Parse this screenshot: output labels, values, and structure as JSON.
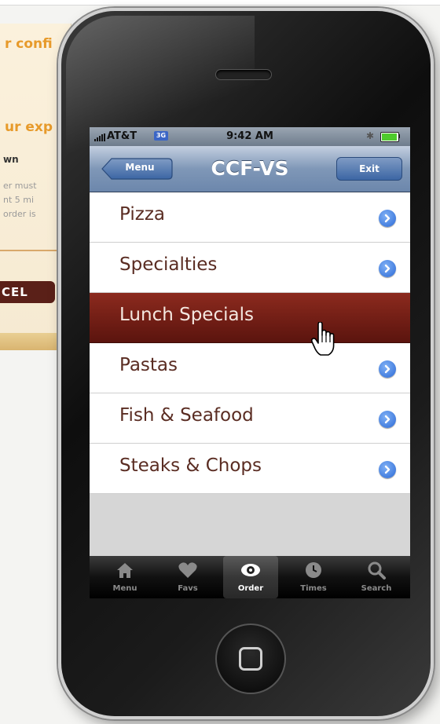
{
  "background_page": {
    "heading_1": "r confi",
    "heading_2": "ur exp",
    "subheading": "wn",
    "body_lines": [
      "er must",
      "nt 5 mi",
      "order is"
    ],
    "cancel_label": "CEL"
  },
  "status_bar": {
    "carrier": "AT&T",
    "network": "3G",
    "time": "9:42 AM",
    "bluetooth_icon": "bluetooth-icon",
    "battery_level": 1.0
  },
  "nav_bar": {
    "title": "CCF-VS",
    "left_button": "Menu",
    "right_button": "Exit"
  },
  "menu_items": [
    {
      "label": "Pizza",
      "selected": false
    },
    {
      "label": "Specialties",
      "selected": false
    },
    {
      "label": "Lunch Specials",
      "selected": true
    },
    {
      "label": "Pastas",
      "selected": false
    },
    {
      "label": "Fish & Seafood",
      "selected": false
    },
    {
      "label": "Steaks & Chops",
      "selected": false
    }
  ],
  "tab_bar": {
    "active": "Order",
    "tabs": [
      {
        "label": "Menu",
        "icon": "home-icon"
      },
      {
        "label": "Favs",
        "icon": "heart-icon"
      },
      {
        "label": "Order",
        "icon": "eye-icon"
      },
      {
        "label": "Times",
        "icon": "clock-icon"
      },
      {
        "label": "Search",
        "icon": "search-icon"
      }
    ]
  },
  "colors": {
    "selected_row": "#6e1d14",
    "item_text": "#5a2c22",
    "nav_blue": "#7f97b7",
    "disclosure_blue": "#2c6ad6"
  }
}
